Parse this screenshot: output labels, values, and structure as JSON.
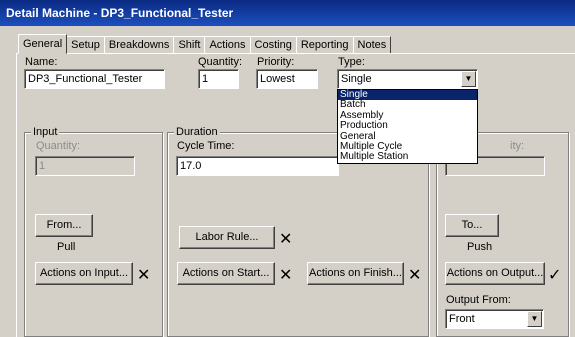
{
  "window": {
    "title": "Detail Machine - DP3_Functional_Tester"
  },
  "tabs": [
    "General",
    "Setup",
    "Breakdowns",
    "Shift",
    "Actions",
    "Costing",
    "Reporting",
    "Notes"
  ],
  "general": {
    "name_label": "Name:",
    "name_value": "DP3_Functional_Tester",
    "quantity_label": "Quantity:",
    "quantity_value": "1",
    "priority_label": "Priority:",
    "priority_value": "Lowest",
    "type_label": "Type:",
    "type_value": "Single"
  },
  "type_options": [
    "Single",
    "Batch",
    "Assembly",
    "Production",
    "General",
    "Multiple Cycle",
    "Multiple Station"
  ],
  "input_group": {
    "title": "Input",
    "quantity_label": "Quantity:",
    "quantity_value": "1",
    "from_button": "From...",
    "pull_label": "Pull",
    "actions_button": "Actions on Input..."
  },
  "duration_group": {
    "title": "Duration",
    "cycle_time_label": "Cycle Time:",
    "cycle_time_value": "17.0",
    "labor_rule_button": "Labor Rule...",
    "actions_start_button": "Actions on Start...",
    "actions_finish_button": "Actions on Finish..."
  },
  "output_group": {
    "quantity_label_partial": "ity:",
    "to_button": "To...",
    "push_label": "Push",
    "actions_button": "Actions on Output...",
    "output_from_label": "Output From:",
    "output_from_value": "Front"
  },
  "icons": {
    "x_mark": "✕",
    "check_mark": "✓",
    "combo_arrow": "▼"
  }
}
